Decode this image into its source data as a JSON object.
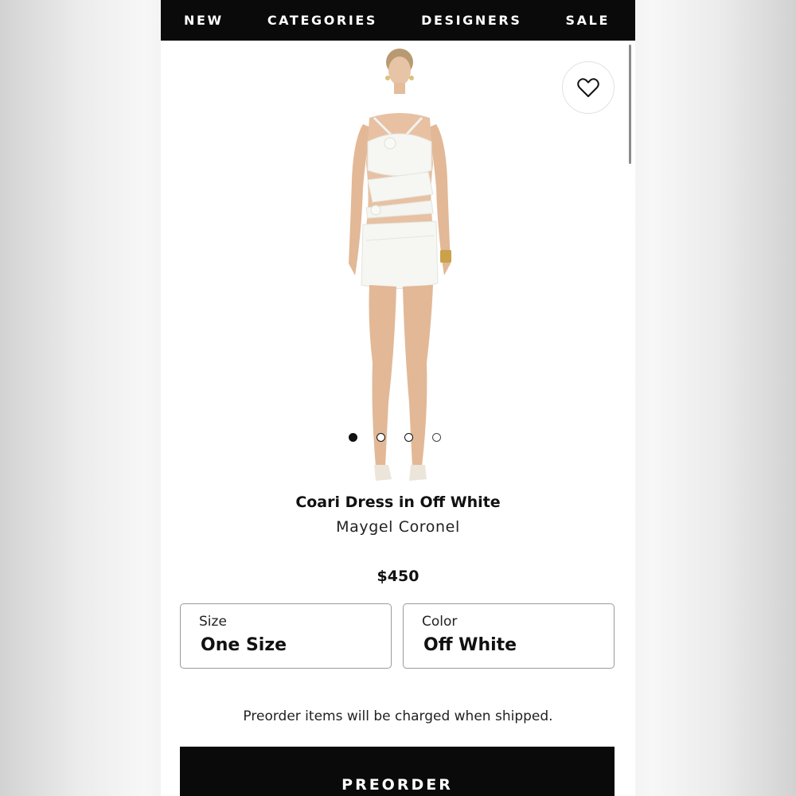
{
  "nav": {
    "items": [
      {
        "label": "NEW"
      },
      {
        "label": "CATEGORIES"
      },
      {
        "label": "DESIGNERS"
      },
      {
        "label": "SALE"
      }
    ]
  },
  "gallery": {
    "image_count": 4,
    "active_index": 0,
    "wishlist_icon": "heart-icon"
  },
  "product": {
    "title": "Coari Dress in Off White",
    "brand": "Maygel Coronel",
    "price": "$450"
  },
  "options": {
    "size": {
      "label": "Size",
      "value": "One Size"
    },
    "color": {
      "label": "Color",
      "value": "Off White"
    }
  },
  "notice": "Preorder items will be charged when shipped.",
  "cta": {
    "label": "PREORDER"
  },
  "colors": {
    "nav_bg": "#0a0a0a",
    "cta_bg": "#0a0a0a",
    "page_bg": "#ffffff"
  }
}
